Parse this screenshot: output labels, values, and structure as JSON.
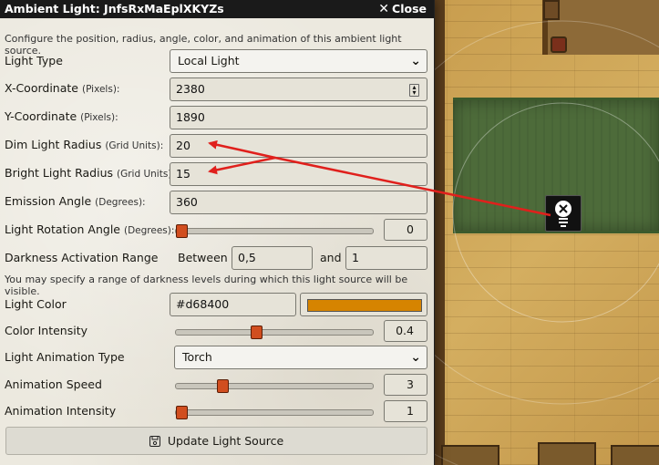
{
  "dialog": {
    "title": "Ambient Light: JnfsRxMaEplXKYZs",
    "close_label": "Close",
    "description": "Configure the position, radius, angle, color, and animation of this ambient light source.",
    "fields": {
      "light_type": {
        "label": "Light Type",
        "value": "Local Light"
      },
      "x_coord": {
        "label": "X-Coordinate",
        "unit": "(Pixels):",
        "value": "2380"
      },
      "y_coord": {
        "label": "Y-Coordinate",
        "unit": "(Pixels):",
        "value": "1890"
      },
      "dim_radius": {
        "label": "Dim Light Radius",
        "unit": "(Grid Units):",
        "value": "20"
      },
      "bright_radius": {
        "label": "Bright Light Radius",
        "unit": "(Grid Units):",
        "value": "15"
      },
      "emission_angle": {
        "label": "Emission Angle",
        "unit": "(Degrees):",
        "value": "360"
      },
      "rotation": {
        "label": "Light Rotation Angle",
        "unit": "(Degrees):",
        "value": "0",
        "fraction": 0.0
      },
      "darkness": {
        "label": "Darkness Activation Range",
        "between": "Between",
        "and": "and",
        "min": "0,5",
        "max": "1"
      },
      "darkness_hint": "You may specify a range of darkness levels during which this light source will be visible.",
      "light_color": {
        "label": "Light Color",
        "value": "#d68400"
      },
      "color_intensity": {
        "label": "Color Intensity",
        "value": "0.4",
        "fraction": 0.4
      },
      "animation_type": {
        "label": "Light Animation Type",
        "value": "Torch"
      },
      "animation_speed": {
        "label": "Animation Speed",
        "value": "3",
        "fraction": 0.22
      },
      "animation_intensity": {
        "label": "Animation Intensity",
        "value": "1",
        "fraction": 0.0
      }
    },
    "submit_label": "Update Light Source"
  },
  "colors": {
    "swatch": "#d68400",
    "arrow": "#e0201c",
    "slider_thumb": "#d14e1f"
  },
  "icons": [
    "close-icon",
    "chevron-down-icon",
    "stepper-icon",
    "save-icon",
    "light-bulb-icon"
  ]
}
